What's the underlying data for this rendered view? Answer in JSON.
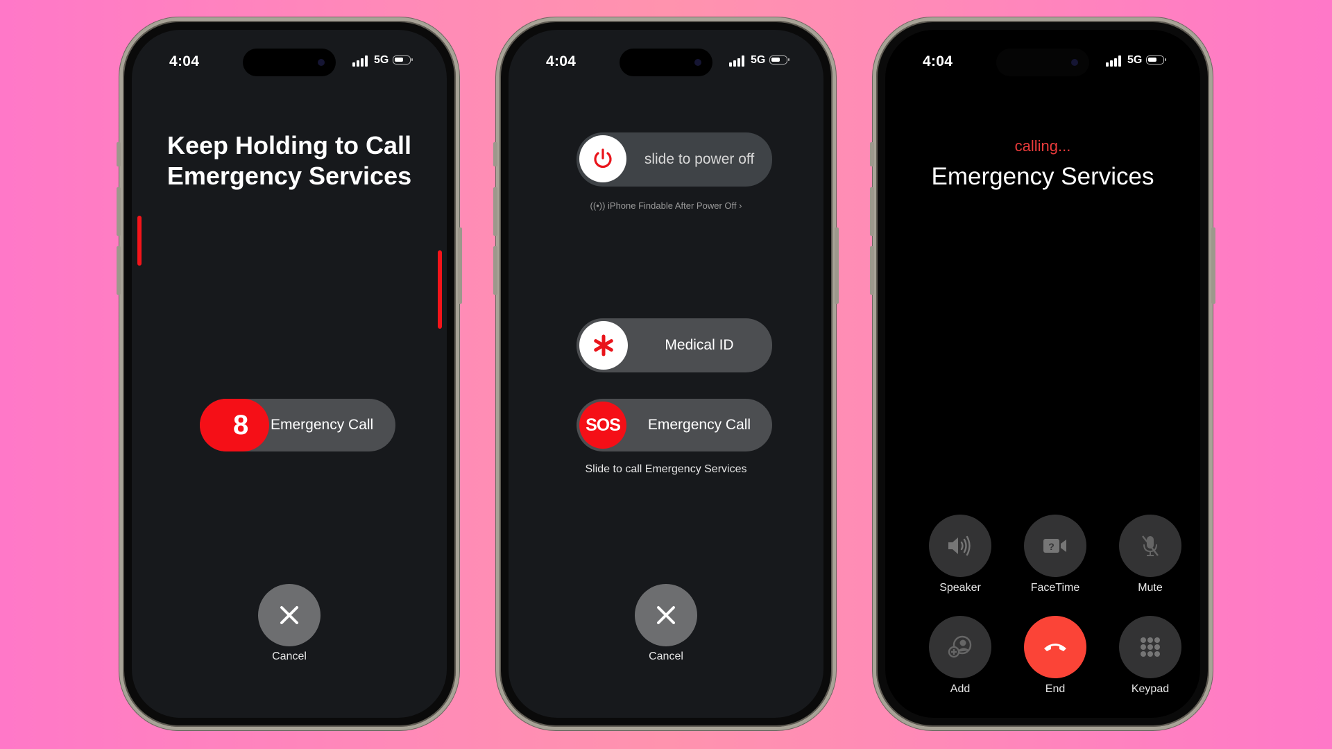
{
  "colors": {
    "background": "#ff8ab8",
    "screen_dark": "#17191c",
    "screen_black": "#000000",
    "emergency_red": "#f50f17",
    "end_red": "#fb4437",
    "calling_red": "#ea3b3b"
  },
  "status_bar": {
    "time": "4:04",
    "network": "5G",
    "signal_icon": "signal-bars-icon",
    "battery_icon": "battery-icon"
  },
  "phone1": {
    "title_line1": "Keep Holding to Call",
    "title_line2": "Emergency Services",
    "countdown": "8",
    "slider_label": "Emergency Call",
    "cancel_label": "Cancel"
  },
  "phone2": {
    "power_slider_label": "slide to power off",
    "findable_text": "iPhone Findable After Power Off",
    "medical_label": "Medical ID",
    "sos_knob": "SOS",
    "emergency_label": "Emergency Call",
    "emergency_hint": "Slide to call Emergency Services",
    "cancel_label": "Cancel"
  },
  "phone3": {
    "status": "calling...",
    "callee": "Emergency Services",
    "buttons": [
      {
        "label": "Speaker",
        "icon": "speaker-icon"
      },
      {
        "label": "FaceTime",
        "icon": "facetime-icon"
      },
      {
        "label": "Mute",
        "icon": "mute-icon"
      },
      {
        "label": "Add",
        "icon": "add-call-icon"
      },
      {
        "label": "End",
        "icon": "end-call-icon"
      },
      {
        "label": "Keypad",
        "icon": "keypad-icon"
      }
    ]
  }
}
